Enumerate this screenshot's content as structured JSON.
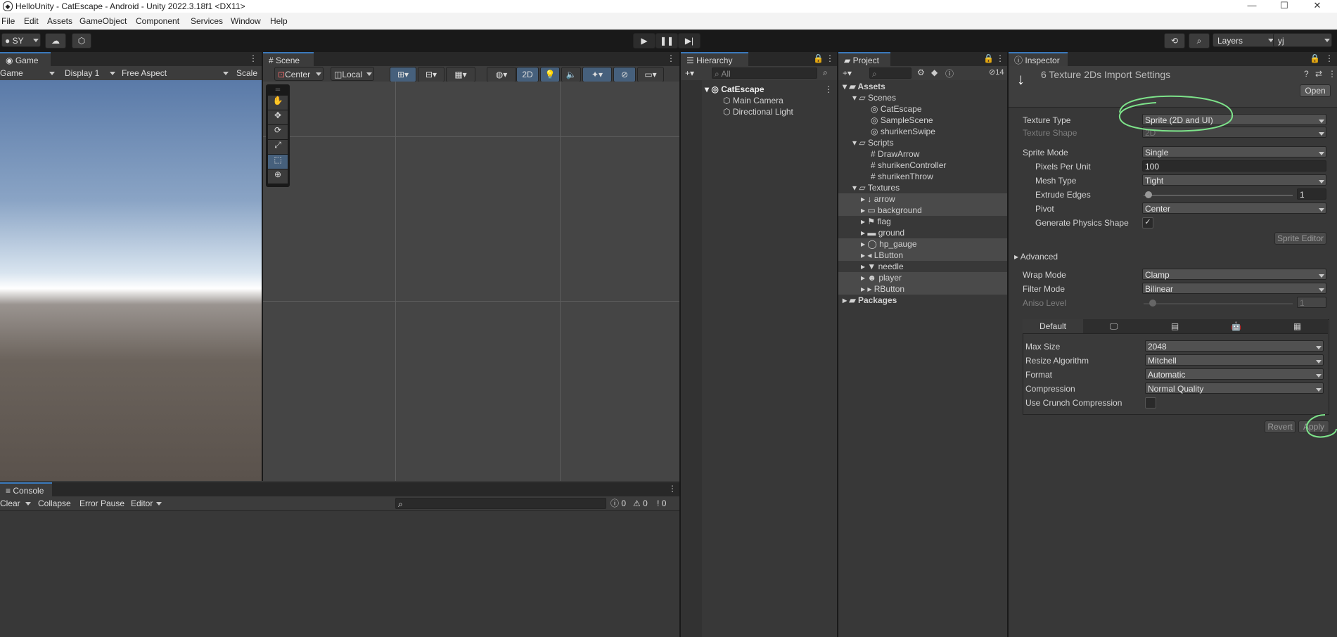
{
  "window": {
    "title": "HelloUnity - CatEscape - Android - Unity 2022.3.18f1 <DX11>"
  },
  "menu": [
    "File",
    "Edit",
    "Assets",
    "GameObject",
    "Component",
    "Services",
    "Window",
    "Help"
  ],
  "toolbar": {
    "account": "SY",
    "layers": "Layers",
    "layout": "yj"
  },
  "game": {
    "tab": "Game",
    "mode": "Game",
    "display": "Display 1",
    "aspect": "Free Aspect",
    "scale": "Scale"
  },
  "scene": {
    "tab": "Scene",
    "pivot": "Center",
    "space": "Local",
    "twod": "2D"
  },
  "console": {
    "tab": "Console",
    "clear": "Clear",
    "collapse": "Collapse",
    "error_pause": "Error Pause",
    "editor": "Editor",
    "counts": [
      "0",
      "0",
      "0"
    ]
  },
  "hierarchy": {
    "tab": "Hierarchy",
    "search_placeholder": "All",
    "root": "CatEscape",
    "children": [
      "Main Camera",
      "Directional Light"
    ]
  },
  "project": {
    "tab": "Project",
    "count": "14",
    "assets": "Assets",
    "scenes_folder": "Scenes",
    "scenes": [
      "CatEscape",
      "SampleScene",
      "shurikenSwipe"
    ],
    "scripts_folder": "Scripts",
    "scripts": [
      "DrawArrow",
      "shurikenController",
      "shurikenThrow"
    ],
    "textures_folder": "Textures",
    "textures": [
      "arrow",
      "background",
      "flag",
      "ground",
      "hp_gauge",
      "LButton",
      "needle",
      "player",
      "RButton"
    ],
    "packages": "Packages"
  },
  "inspector": {
    "tab": "Inspector",
    "header": "6 Texture 2Ds Import Settings",
    "open": "Open",
    "texture_type_label": "Texture Type",
    "texture_type": "Sprite (2D and UI)",
    "texture_shape_label": "Texture Shape",
    "texture_shape": "2D",
    "sprite_mode_label": "Sprite Mode",
    "sprite_mode": "Single",
    "ppu_label": "Pixels Per Unit",
    "ppu": "100",
    "mesh_type_label": "Mesh Type",
    "mesh_type": "Tight",
    "extrude_label": "Extrude Edges",
    "extrude": "1",
    "pivot_label": "Pivot",
    "pivot": "Center",
    "physics_label": "Generate Physics Shape",
    "sprite_editor": "Sprite Editor",
    "advanced": "Advanced",
    "wrap_label": "Wrap Mode",
    "wrap": "Clamp",
    "filter_label": "Filter Mode",
    "filter": "Bilinear",
    "aniso_label": "Aniso Level",
    "aniso": "1",
    "platform_default": "Default",
    "max_size_label": "Max Size",
    "max_size": "2048",
    "resize_label": "Resize Algorithm",
    "resize": "Mitchell",
    "format_label": "Format",
    "format": "Automatic",
    "compression_label": "Compression",
    "compression": "Normal Quality",
    "crunch_label": "Use Crunch Compression",
    "revert": "Revert",
    "apply": "Apply"
  },
  "colors": {
    "accent": "#3a79bb",
    "annotation": "#7de38a",
    "sky_top": "#5a7aa8",
    "ground": "#5a524c"
  }
}
